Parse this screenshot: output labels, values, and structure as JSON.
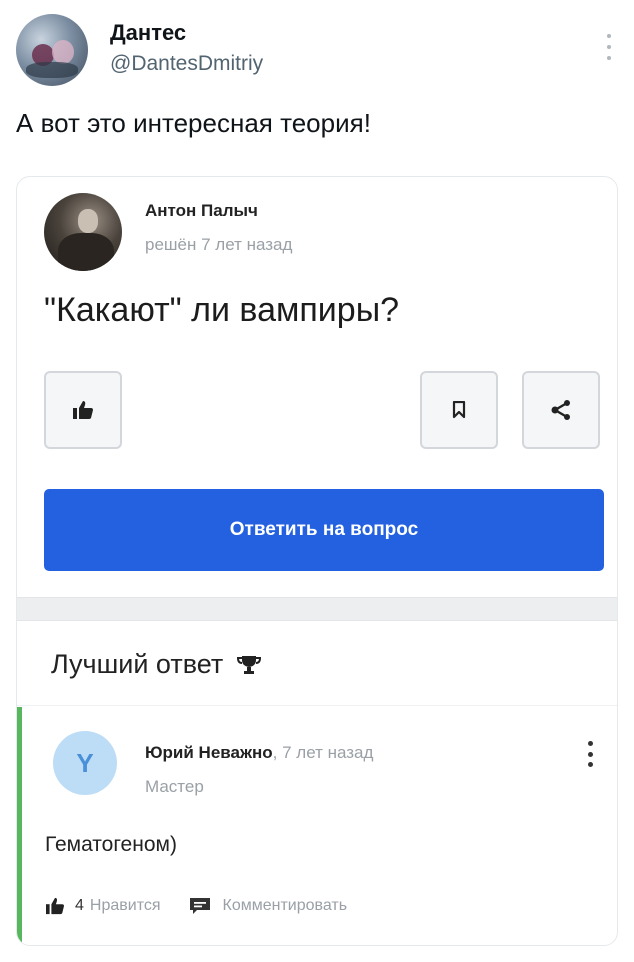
{
  "tweet": {
    "author_name": "Дантес",
    "author_handle": "@DantesDmitriy",
    "text": "А вот это интересная теория!"
  },
  "card": {
    "question": {
      "author": "Антон Палыч",
      "meta": "решён 7 лет назад",
      "title": "\"Какают\" ли вампиры?",
      "answer_button_label": "Ответить на вопрос"
    },
    "best_answer": {
      "section_title": "Лучший ответ",
      "avatar_letter": "Y",
      "author": "Юрий Неважно",
      "time": ", 7 лет назад",
      "rank": "Мастер",
      "text": "Гематогеном)",
      "likes_count": "4",
      "like_label": "Нравится",
      "comment_label": "Комментировать"
    }
  },
  "colors": {
    "accent_blue": "#2461e0",
    "answer_accent_green": "#58b65e",
    "avatar_letter_bg": "#bddcf6"
  }
}
